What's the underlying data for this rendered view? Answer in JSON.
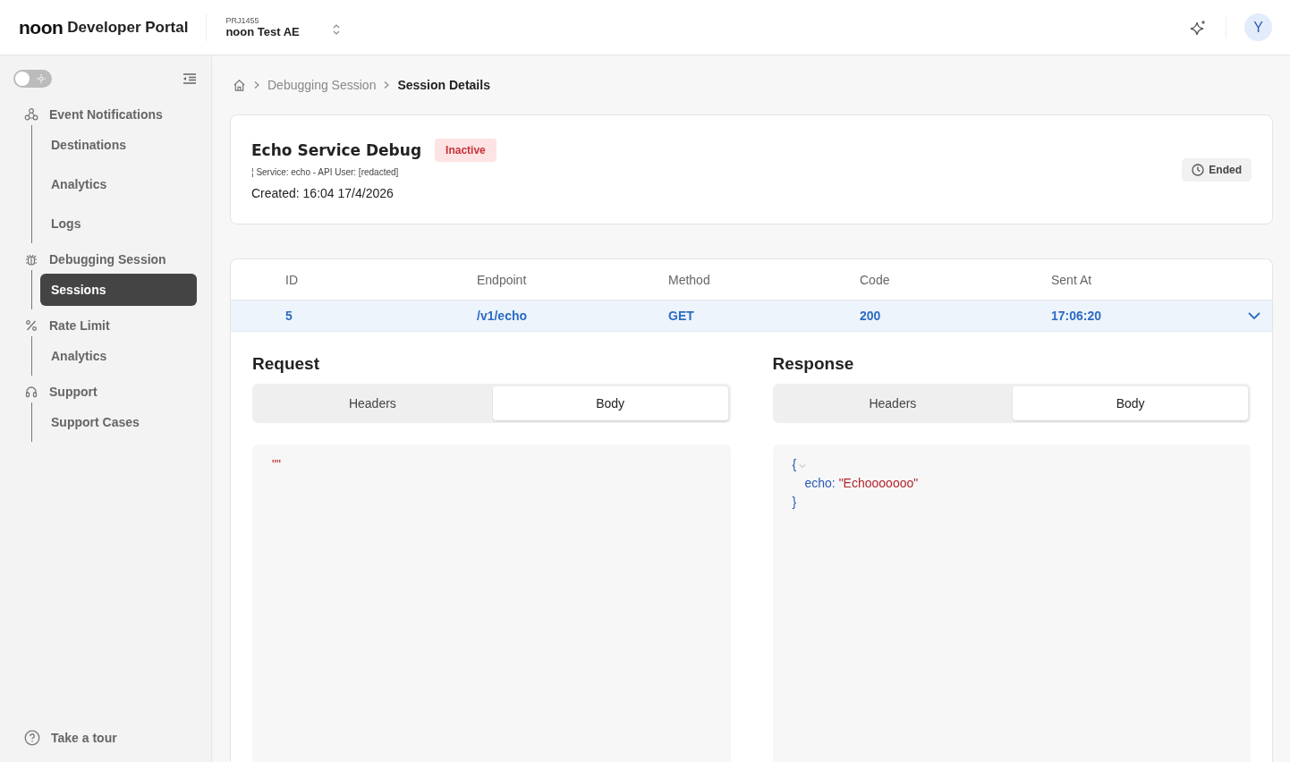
{
  "header": {
    "logo": "noon",
    "title": "Developer Portal",
    "project": {
      "id": "PRJ1455",
      "name": "noon Test AE"
    },
    "avatar": "Y"
  },
  "sidebar": {
    "theme_toggle": {
      "on": false
    },
    "groups": [
      {
        "label": "Event Notifications",
        "children": [
          {
            "label": "Destinations",
            "selected": false
          },
          {
            "label": "Analytics",
            "selected": false
          },
          {
            "label": "Logs",
            "selected": false
          }
        ]
      },
      {
        "label": "Debugging Session",
        "children": [
          {
            "label": "Sessions",
            "selected": true
          }
        ]
      },
      {
        "label": "Rate Limit",
        "children": [
          {
            "label": "Analytics",
            "selected": false
          }
        ]
      },
      {
        "label": "Support",
        "children": [
          {
            "label": "Support Cases",
            "selected": false
          }
        ]
      }
    ],
    "tour": "Take a tour"
  },
  "breadcrumb": [
    {
      "label": "Debugging Session",
      "current": false
    },
    {
      "label": "Session Details",
      "current": true
    }
  ],
  "session": {
    "title": "Echo Service Debug",
    "status": "Inactive",
    "meta": "¦ Service: echo - API User: [redacted]",
    "created": "Created: 16:04 17/4/2026",
    "end_button": "Ended"
  },
  "table": {
    "columns": [
      "ID",
      "Endpoint",
      "Method",
      "Code",
      "Sent At"
    ],
    "rows": [
      {
        "cells": [
          "5",
          "/v1/echo",
          "GET",
          "200",
          "17:06:20"
        ],
        "selected": true,
        "expanded": true
      }
    ]
  },
  "panels": [
    {
      "title": "Request",
      "tabs": [
        {
          "label": "Headers",
          "selected": false
        },
        {
          "label": "Body",
          "selected": true
        }
      ],
      "lines": [
        {
          "kind": "string",
          "text": "\"\""
        }
      ]
    },
    {
      "title": "Response",
      "tabs": [
        {
          "label": "Headers",
          "selected": false
        },
        {
          "label": "Body",
          "selected": true
        }
      ],
      "lines": [
        {
          "kind": "open",
          "text": "{",
          "collapsible": true
        },
        {
          "kind": "pair",
          "key": "echo:",
          "value": "\"Echooooooo\""
        },
        {
          "kind": "close",
          "text": "}"
        }
      ]
    }
  ]
}
